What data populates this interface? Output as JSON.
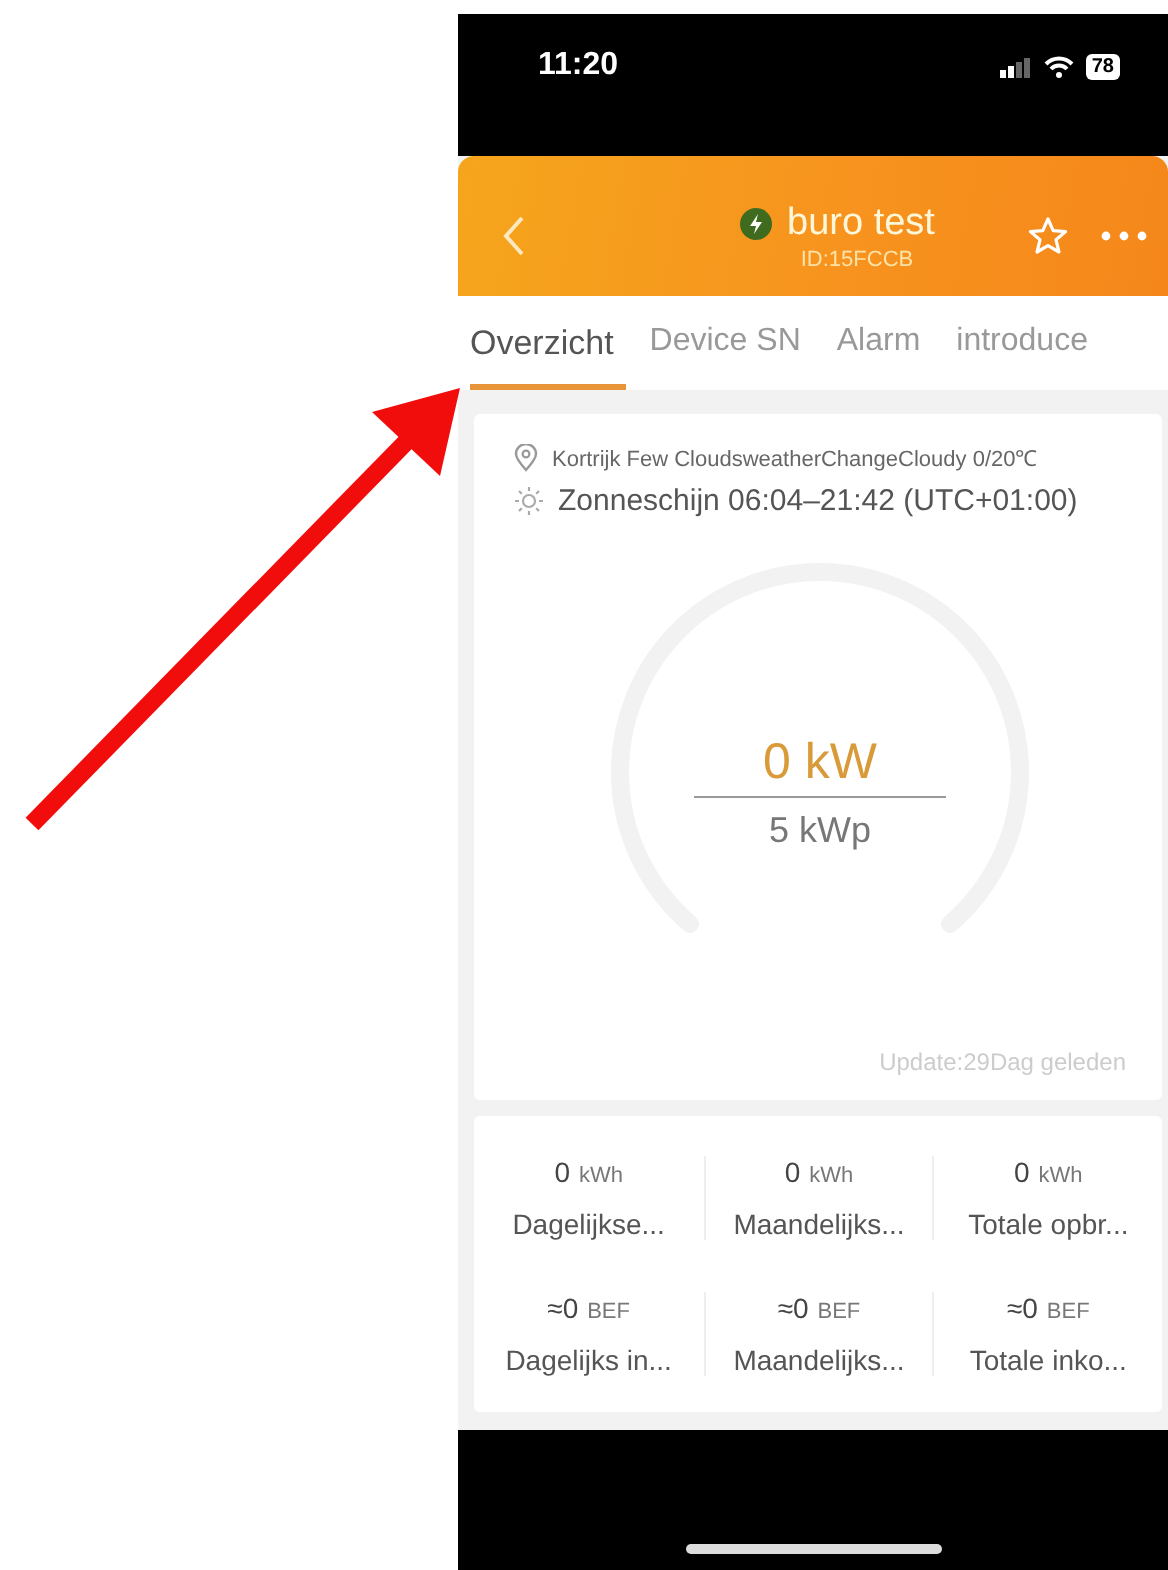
{
  "status_bar": {
    "time": "11:20",
    "battery": "78"
  },
  "header": {
    "title": "buro test",
    "device_id": "ID:15FCCB",
    "online": true
  },
  "tabs": [
    {
      "label": "Overzicht",
      "selected": true
    },
    {
      "label": "Device SN",
      "selected": false
    },
    {
      "label": "Alarm",
      "selected": false
    },
    {
      "label": "introduce",
      "selected": false
    }
  ],
  "overview": {
    "weather": "Kortrijk Few CloudsweatherChangeCloudy 0/20℃",
    "sunshine": "Zonneschijn 06:04–21:42 (UTC+01:00)",
    "power": "0 kW",
    "capacity": "5 kWp",
    "update": "Update:29Dag geleden"
  },
  "stats": [
    {
      "value": "0",
      "unit": "kWh",
      "label": "Dagelijkse..."
    },
    {
      "value": "0",
      "unit": "kWh",
      "label": "Maandelijks..."
    },
    {
      "value": "0",
      "unit": "kWh",
      "label": "Totale opbr..."
    },
    {
      "value": "≈0",
      "unit": "BEF",
      "label": "Dagelijks in..."
    },
    {
      "value": "≈0",
      "unit": "BEF",
      "label": "Maandelijks..."
    },
    {
      "value": "≈0",
      "unit": "BEF",
      "label": "Totale inko..."
    }
  ]
}
